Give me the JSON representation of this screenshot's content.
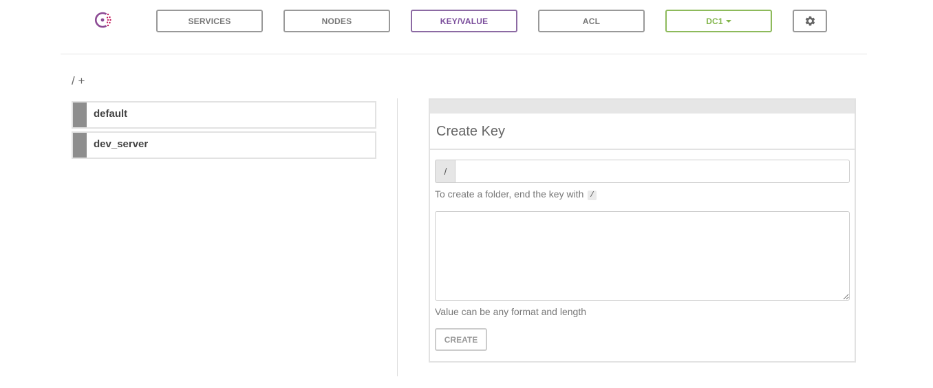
{
  "nav": {
    "services": "SERVICES",
    "nodes": "NODES",
    "keyvalue": "KEY/VALUE",
    "acl": "ACL",
    "datacenter": "DC1"
  },
  "colors": {
    "brand": "#8c6aa3",
    "datacenter": "#82b54b",
    "key_bar": "#8e8e8e"
  },
  "icons": {
    "logo": "consul-logo-icon",
    "settings": "gear-icon",
    "dropdown": "chevron-down-icon"
  },
  "breadcrumb": {
    "root": "/",
    "add": "+"
  },
  "keys": [
    {
      "label": "default"
    },
    {
      "label": "dev_server"
    }
  ],
  "create_panel": {
    "title": "Create Key",
    "key_prefix": "/",
    "key_value": "",
    "folder_help": "To create a folder, end the key with",
    "folder_help_code": "/",
    "value": "",
    "value_help": "Value can be any format and length",
    "create_label": "CREATE"
  }
}
